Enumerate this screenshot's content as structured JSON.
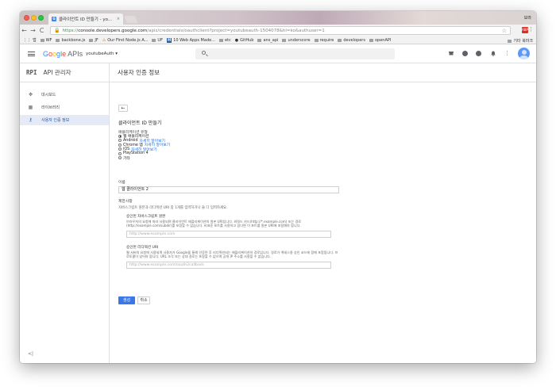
{
  "browser": {
    "tab_title": "클라이언트 ID 만들기 - youtubeAu",
    "tab_close": "×",
    "profile_name": "보라",
    "url_scheme": "https://",
    "url_host": "console.developers.google.com",
    "url_path": "/apis/credentials/oauthclient?project=youtubeauth-1504078&hl=ko&authuser=1",
    "back": "←",
    "forward": "→",
    "reload": "C",
    "star": "☆",
    "menu": "⋮",
    "bookmarks": [
      "앱",
      "WF",
      "backbone.js",
      "JF",
      "Our First Node.js A...",
      "UF",
      "10 Web Apps Made...",
      "etc",
      "GitHub",
      "ans_api",
      "underscore",
      "require",
      "developers",
      "openAPI"
    ],
    "bookmarks_other": "기타 북마크"
  },
  "header": {
    "logo_letters": [
      "G",
      "o",
      "o",
      "g",
      "l",
      "e"
    ],
    "logo_suffix": " APIs",
    "project": "youtubeAuth ▾"
  },
  "sidebar": {
    "api_icon": "RPI",
    "title": "API 관리자",
    "items": [
      {
        "icon": "✥",
        "label": "대시보드"
      },
      {
        "icon": "▦",
        "label": "라이브러리"
      },
      {
        "icon": "⚷",
        "label": "사용자 인증 정보"
      }
    ],
    "collapse": "<|"
  },
  "main": {
    "page_title": "사용자 인증 정보",
    "back_button": "←",
    "section_title": "클라이언트 ID 만들기",
    "app_type_label": "애플리케이션 유형",
    "app_types": [
      {
        "label": "웹 애플리케이션",
        "link": ""
      },
      {
        "label": "Android",
        "link": "자세히 알아보기"
      },
      {
        "label": "Chrome 앱",
        "link": "자세히 알아보기"
      },
      {
        "label": "iOS",
        "link": "자세히 알아보기"
      },
      {
        "label": "PlayStation 4",
        "link": ""
      },
      {
        "label": "기타",
        "link": ""
      }
    ],
    "name_label": "이름",
    "name_value": "웹 클라이언트 2",
    "restrictions_title": "제한사항",
    "restrictions_desc": "자바스크립트 원본과 리디렉션 URI 중 1개를 입력하거나 둘 다 입력하세요.",
    "js_origins_title": "승인된 자바스크립트 원본",
    "js_origins_desc": "브라우저의 요청에 따라 사용되며 클라이언트 애플리케이션의 원본 URI입니다. 와일드 카드(http://*.example.com) 또는 경로(http://example.com/subdir)를 포함할 수 없습니다. 비표준 포트를 사용하고 있다면 이 포트를 원본 URI에 포함해야 합니다.",
    "js_origins_placeholder": "http://www.example.com",
    "redirect_title": "승인된 리디렉션 URI",
    "redirect_desc": "웹 서버의 요청에 사용되며 사용자가 Google을 통해 인증된 후 리디렉션되는 애플리케이션의 경로입니다. 경로가 액세스용 승인 코드에 함께 포함됩니다. 프로토콜이 있어야 합니다. URL 조각 또는 상대 경로는 포함할 수 없으며 공개 IP 주소를 사용할 수 없습니다.",
    "redirect_placeholder": "http://www.example.com/oauth2callback",
    "create_button": "생성",
    "cancel_button": "취소"
  }
}
